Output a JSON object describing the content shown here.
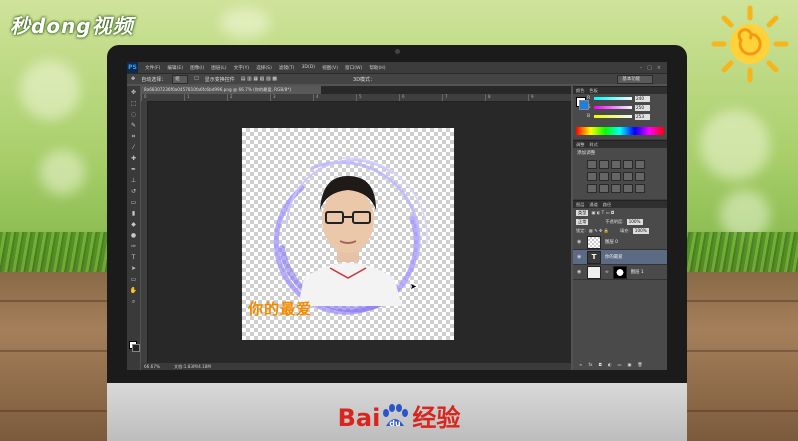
{
  "watermark": {
    "brand": "秒dong视频"
  },
  "photoshop": {
    "app_logo": "PS",
    "menu": [
      "文件(F)",
      "编辑(E)",
      "图像(I)",
      "图层(L)",
      "文字(Y)",
      "选择(S)",
      "滤镜(T)",
      "3D(D)",
      "视图(V)",
      "窗口(W)",
      "帮助(H)"
    ],
    "options": {
      "auto_select": "自动选择：",
      "layer_dropdown": "组",
      "show_transform": "显示变换控件",
      "mode_3d": "3D模式：",
      "workspace": "基本功能"
    },
    "doc_tab": "8a68307236f0a0457810fa6fc6bd996.png @ 66.7% (你的最爱, RGB/8*)",
    "ruler_ticks": [
      "0",
      "1",
      "2",
      "3",
      "4",
      "5",
      "6",
      "7",
      "8",
      "9"
    ],
    "status": {
      "zoom": "66.67%",
      "doc": "文档:1.83M/4.18M"
    },
    "canvas_caption": "你的最爱",
    "color_panel": {
      "tabs": [
        "颜色",
        "色板"
      ],
      "channels": [
        {
          "label": "R",
          "value": "240"
        },
        {
          "label": "G",
          "value": "250"
        },
        {
          "label": "B",
          "value": "253"
        }
      ]
    },
    "adjust_panel": {
      "tabs": [
        "调整",
        "样式"
      ],
      "title": "添加调整"
    },
    "layers_panel": {
      "tabs": [
        "图层",
        "通道",
        "路径"
      ],
      "kind": "类型",
      "blend_mode": "正常",
      "opacity_label": "不透明度:",
      "opacity": "100%",
      "lock_label": "锁定:",
      "fill_label": "填充:",
      "fill": "100%",
      "layers": [
        {
          "name": "图层 0",
          "type": "pixel"
        },
        {
          "name": "你的最爱",
          "type": "text"
        },
        {
          "name": "图层 1",
          "type": "masked"
        }
      ]
    }
  },
  "footer": {
    "bai": "Bai",
    "du": "du",
    "jingyan": "经验"
  },
  "colors": {
    "orange_caption": "#f28a00",
    "baidu_red": "#d9251c",
    "baidu_blue": "#2b56c8"
  }
}
